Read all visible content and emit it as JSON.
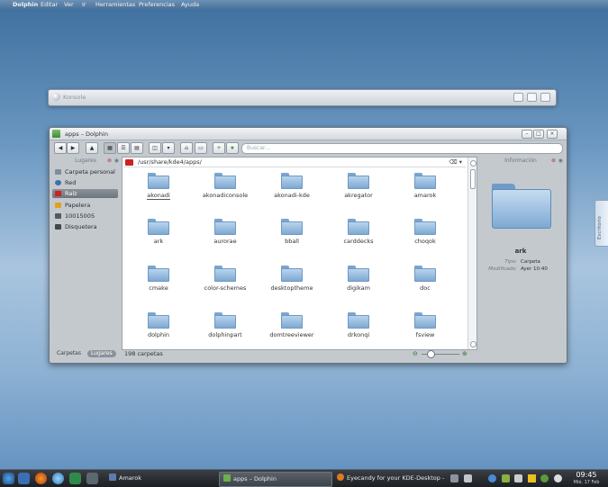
{
  "menubar": {
    "app": "Dolphin",
    "items": [
      "Editar",
      "Ver",
      "Ir",
      "Herramientas",
      "Preferencias",
      "Ayuda"
    ]
  },
  "thin_window": {
    "title": "Konsole"
  },
  "window": {
    "title": "apps – Dolphin",
    "search_placeholder": "Buscar...",
    "location": "/usr/share/kde4/apps/",
    "places_panel": {
      "header": "Lugares",
      "items": [
        {
          "label": "Carpeta personal",
          "icon": "home-icon",
          "color": "#7d8d9c"
        },
        {
          "label": "Red",
          "icon": "network-icon",
          "color": "#3b6fb0"
        },
        {
          "label": "Raíz",
          "icon": "root-folder-icon",
          "color": "#d02020",
          "selected": true
        },
        {
          "label": "Papelera",
          "icon": "trash-icon",
          "color": "#e0a020"
        },
        {
          "label": "10015005",
          "icon": "harddisk-icon",
          "color": "#505a64"
        },
        {
          "label": "Disquetera",
          "icon": "floppy-icon",
          "color": "#404850"
        }
      ]
    },
    "files": [
      "akonadi",
      "akonadiconsole",
      "akonadi-kde",
      "akregator",
      "amarok",
      "ark",
      "aurorae",
      "bball",
      "carddecks",
      "choqok",
      "cmake",
      "color-schemes",
      "desktoptheme",
      "digikam",
      "doc",
      "dolphin",
      "dolphinpart",
      "domtreeviewer",
      "drkonqi",
      "fsview"
    ],
    "info_panel": {
      "header": "Información",
      "name": "ark",
      "type_label": "Tipo:",
      "type_value": "Carpeta",
      "modified_label": "Modificado:",
      "modified_value": "Ayer 10:40"
    },
    "panel_tabs": [
      "Carpetas",
      "Lugares"
    ],
    "status": "198 carpetas"
  },
  "side_tab": {
    "label": "Escritorio"
  },
  "taskbar": {
    "tasks": [
      {
        "label": "Amarok",
        "active": false
      },
      {
        "label": "apps – Dolphin",
        "active": true
      },
      {
        "label": "Eyecandy for your KDE-Desktop - KD",
        "active": false
      }
    ],
    "clock_time": "09:45",
    "clock_date": "Mié, 17 Feb"
  },
  "colors": {
    "accent_selection": "#6c747c",
    "folder": "#7fa9d2",
    "raiz_icon": "#d02020"
  }
}
